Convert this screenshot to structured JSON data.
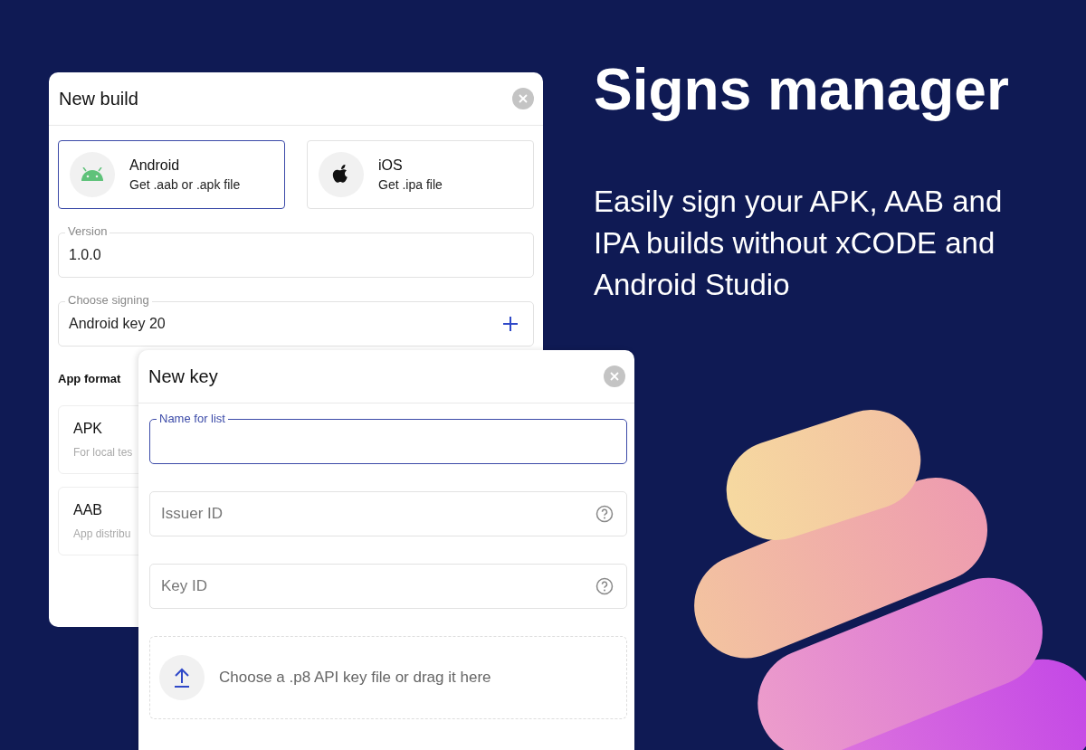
{
  "hero": {
    "title": "Signs manager",
    "subtitle": "Easily sign your APK, AAB and IPA builds without xCODE and Android Studio"
  },
  "build_dialog": {
    "title": "New build",
    "platforms": [
      {
        "name": "Android",
        "description": "Get .aab or .apk file",
        "selected": true,
        "kind": "android"
      },
      {
        "name": "iOS",
        "description": "Get .ipa file",
        "selected": false,
        "kind": "apple"
      }
    ],
    "fields": [
      {
        "label": "Version",
        "value": "1.0.0",
        "kind": "text"
      },
      {
        "label": "Choose signing",
        "value": "Android key 20",
        "kind": "add"
      }
    ],
    "app_format": {
      "label": "App format",
      "options": [
        {
          "name": "APK",
          "description": "For local tes"
        },
        {
          "name": "AAB",
          "description": "App distribu"
        }
      ]
    }
  },
  "key_dialog": {
    "title": "New key",
    "fields": [
      {
        "label": "Name for list",
        "focused": true,
        "kind": "text"
      },
      {
        "placeholder": "Issuer ID",
        "focused": false,
        "kind": "help"
      },
      {
        "placeholder": "Key ID",
        "focused": false,
        "kind": "help"
      }
    ],
    "upload": {
      "text": "Choose a .p8 API key file or drag it here"
    }
  }
}
